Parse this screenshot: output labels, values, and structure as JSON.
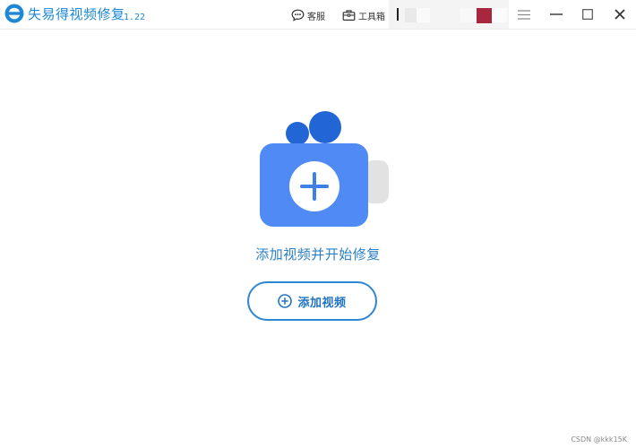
{
  "app": {
    "title": "失易得视频修复",
    "version": "1.22"
  },
  "toolbar": {
    "support_label": "客服",
    "toolbox_label": "工具箱"
  },
  "main": {
    "prompt": "添加视频并开始修复",
    "add_button_label": "添加视频"
  },
  "watermark": "CSDN @kkk15K",
  "colors": {
    "accent": "#2f86d2",
    "camera_body": "#4f8af5",
    "camera_knob": "#2265d4",
    "user_avatar": "#a8273f"
  },
  "icons": {
    "logo": "app-logo-icon",
    "support": "chat-bubble-icon",
    "toolbox": "toolbox-icon",
    "menu": "hamburger-menu-icon",
    "minimize": "minimize-icon",
    "maximize": "maximize-icon",
    "close": "close-icon",
    "add": "plus-circle-icon"
  }
}
